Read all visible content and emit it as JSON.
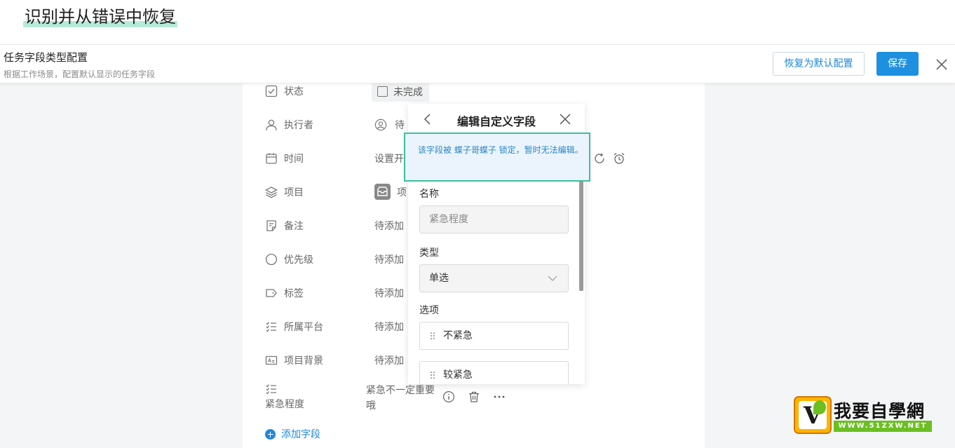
{
  "heading": "识别并从错误中恢复",
  "topbar": {
    "title": "任务字段类型配置",
    "subtitle": "根据工作场景，配置默认显示的任务字段",
    "reset_label": "恢复为默认配置",
    "save_label": "保存",
    "close_icon": "close-icon"
  },
  "fields": {
    "status": {
      "label": "状态",
      "value": "未完成",
      "icon": "checkbox-icon"
    },
    "assignee": {
      "label": "执行者",
      "value": "待",
      "icon": "user-icon"
    },
    "time": {
      "label": "时间",
      "value": "设置开",
      "icon": "calendar-icon"
    },
    "project": {
      "label": "项目",
      "value": "项",
      "icon": "layers-icon"
    },
    "note": {
      "label": "备注",
      "value": "待添加",
      "icon": "note-icon"
    },
    "priority": {
      "label": "优先级",
      "value": "待添加",
      "icon": "circle-icon"
    },
    "tag": {
      "label": "标签",
      "value": "待添加",
      "icon": "tag-icon"
    },
    "platform": {
      "label": "所属平台",
      "value": "待添加",
      "icon": "list-icon"
    },
    "background": {
      "label": "项目背景",
      "value": "待添加",
      "icon": "text-icon"
    },
    "urgency": {
      "label": "紧急程度",
      "value": "紧急不一定重要哦",
      "icon": "list-icon"
    }
  },
  "add_field": "添加字段",
  "popup": {
    "title": "编辑自定义字段",
    "notice": "该字段被 蝶子哥蝶子 锁定，暂时无法编辑。",
    "name_label": "名称",
    "name_value": "紧急程度",
    "type_label": "类型",
    "type_value": "单选",
    "options_label": "选项",
    "options": [
      "不紧急",
      "较紧急"
    ]
  },
  "watermark": {
    "cn": "我要自學網",
    "url": "WWW.51ZXW.NET"
  },
  "colors": {
    "accent": "#1e90e0",
    "notice_border": "#3cbf9c",
    "notice_bg": "#ebf4fc"
  }
}
